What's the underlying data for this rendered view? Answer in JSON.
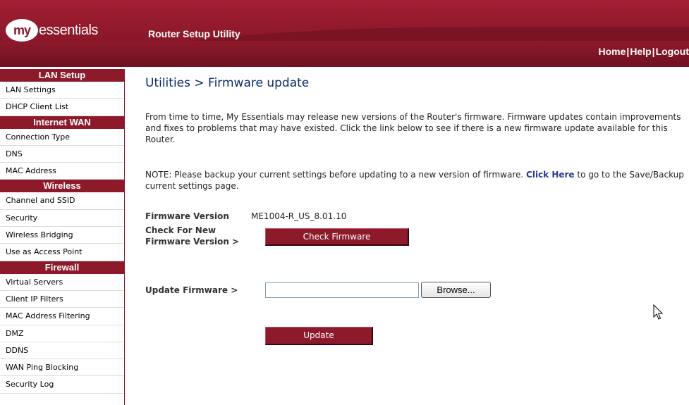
{
  "header": {
    "logo_my": "my",
    "logo_text": "essentials",
    "app_title": "Router Setup Utility",
    "links": [
      "Home",
      "Help",
      "Logout"
    ],
    "link_separator": "|",
    "brand_color": "#8d1a2b"
  },
  "sidebar": {
    "sections": [
      {
        "title": "LAN Setup",
        "items": [
          "LAN Settings",
          "DHCP Client List"
        ]
      },
      {
        "title": "Internet WAN",
        "items": [
          "Connection Type",
          "DNS",
          "MAC Address"
        ]
      },
      {
        "title": "Wireless",
        "items": [
          "Channel and SSID",
          "Security",
          "Wireless Bridging",
          "Use as Access Point"
        ]
      },
      {
        "title": "Firewall",
        "items": [
          "Virtual Servers",
          "Client IP Filters",
          "MAC Address Filtering",
          "DMZ",
          "DDNS",
          "WAN Ping Blocking",
          "Security Log"
        ]
      }
    ]
  },
  "main": {
    "title": "Utilities > Firmware update",
    "para1": "From time to time, My Essentials may release new versions of the Router's firmware. Firmware updates contain improvements and fixes to problems that may have existed. Click the link below to see if there is a new firmware update available for this Router.",
    "note_before": "NOTE: Please backup your current settings before updating to a new version of firmware. ",
    "note_link": "Click Here",
    "note_after": " to go to the Save/Backup current settings page.",
    "firmware_version_label": "Firmware Version",
    "firmware_version_value": "ME1004-R_US_8.01.10",
    "check_label_line1": "Check For New",
    "check_label_line2": "Firmware Version >",
    "check_button": "Check Firmware",
    "update_label": "Update Firmware >",
    "file_value": "",
    "browse_button": "Browse...",
    "update_button": "Update"
  }
}
